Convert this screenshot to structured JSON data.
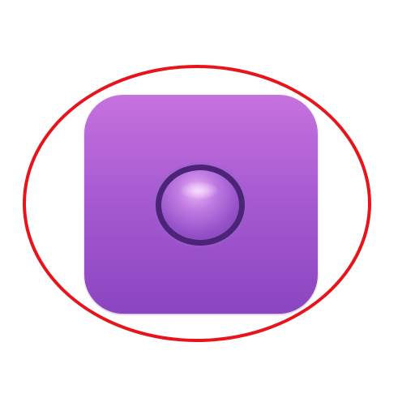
{
  "colors": {
    "highlight_ring": "#e8141b",
    "icon_top": "#c672de",
    "icon_bottom": "#8b45c0",
    "button_rim": "#4b2377",
    "button_fill": "#9653c9"
  },
  "icons": {
    "app_icon": "purple-rounded-square-app-icon",
    "center_glyph": "circle-record-icon"
  }
}
